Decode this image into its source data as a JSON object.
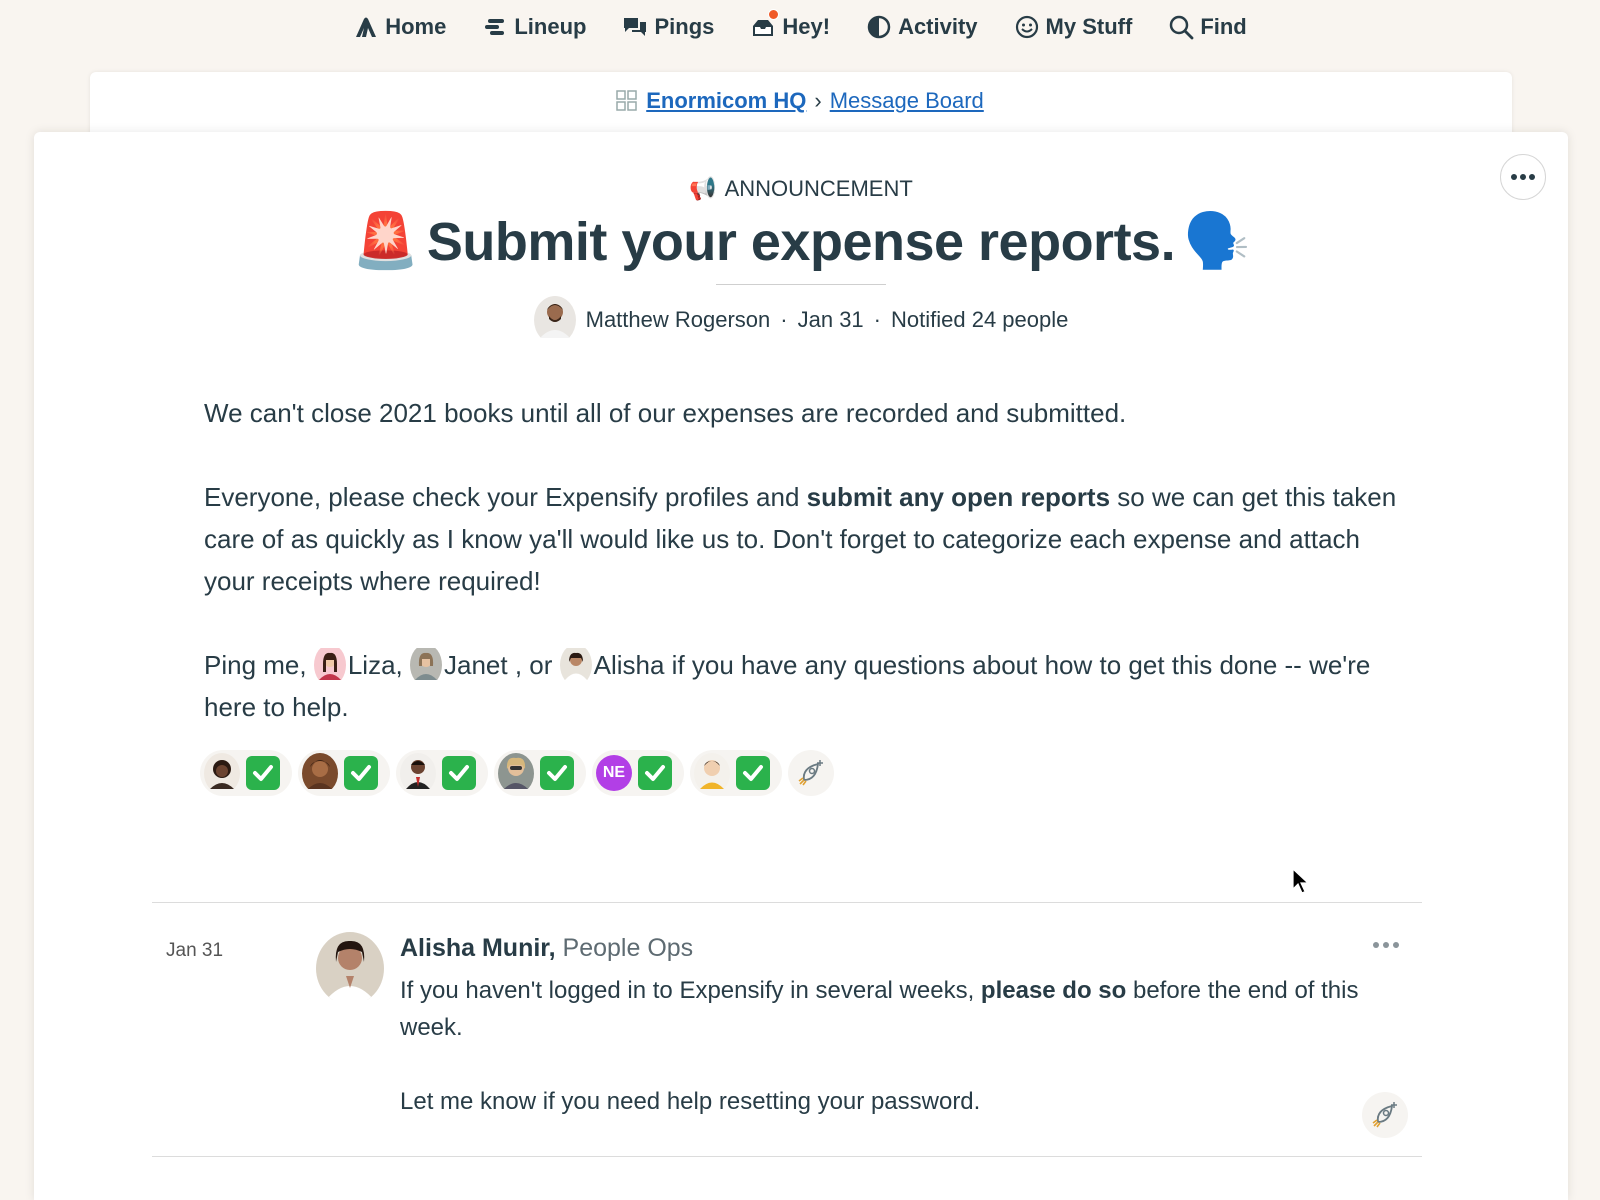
{
  "nav": {
    "items": [
      {
        "label": "Home",
        "icon": "home-icon"
      },
      {
        "label": "Lineup",
        "icon": "lineup-icon"
      },
      {
        "label": "Pings",
        "icon": "pings-icon"
      },
      {
        "label": "Hey!",
        "icon": "hey-icon"
      },
      {
        "label": "Activity",
        "icon": "activity-icon"
      },
      {
        "label": "My Stuff",
        "icon": "my-stuff-icon"
      },
      {
        "label": "Find",
        "icon": "find-icon"
      }
    ]
  },
  "breadcrumb": {
    "project": "Enormicom HQ",
    "separator": "›",
    "tool": "Message Board"
  },
  "message": {
    "category": "ANNOUNCEMENT",
    "category_emoji": "📢",
    "title": "Submit your expense reports.",
    "title_prefix_emoji": "🚨",
    "title_suffix_emoji": "🗣️",
    "author": "Matthew Rogerson",
    "date": "Jan 31",
    "notified": "Notified 24 people",
    "byline_sep": "·",
    "paragraph1": "We can't close 2021 books until all of our expenses are recorded and submitted.",
    "paragraph2_pre": "Everyone, please check your Expensify profiles and ",
    "paragraph2_bold": "submit any open reports",
    "paragraph2_post": " so we can get this taken care of as quickly as I know ya'll would like us to. Don't forget to categorize each expense and attach your receipts where required!",
    "paragraph3_pre": "Ping me, ",
    "mention1": "Liza",
    "paragraph3_sep1": ", ",
    "mention2": "Janet",
    "paragraph3_sep2": " , or ",
    "mention3": "Alisha",
    "paragraph3_post": " if you have any questions about how to get this done -- we're here to help.",
    "boosts": [
      {
        "avatar": "avatar-1"
      },
      {
        "avatar": "avatar-2"
      },
      {
        "avatar": "avatar-3"
      },
      {
        "avatar": "avatar-4"
      },
      {
        "avatar": "NE"
      },
      {
        "avatar": "avatar-6"
      }
    ]
  },
  "comment": {
    "date": "Jan 31",
    "author": "Alisha Munir,",
    "role": " People Ops",
    "line1_pre": "If you haven't logged in to Expensify in several weeks, ",
    "line1_bold": "please do so",
    "line1_post": " before the end of this week.",
    "line2": "Let me know if you need help resetting your password."
  },
  "colors": {
    "background": "#f9f5f0",
    "text": "#283c46",
    "link": "#1d68bd",
    "check": "#2bb24c",
    "ne_avatar": "#b23fe6",
    "notif": "#f05a28"
  }
}
